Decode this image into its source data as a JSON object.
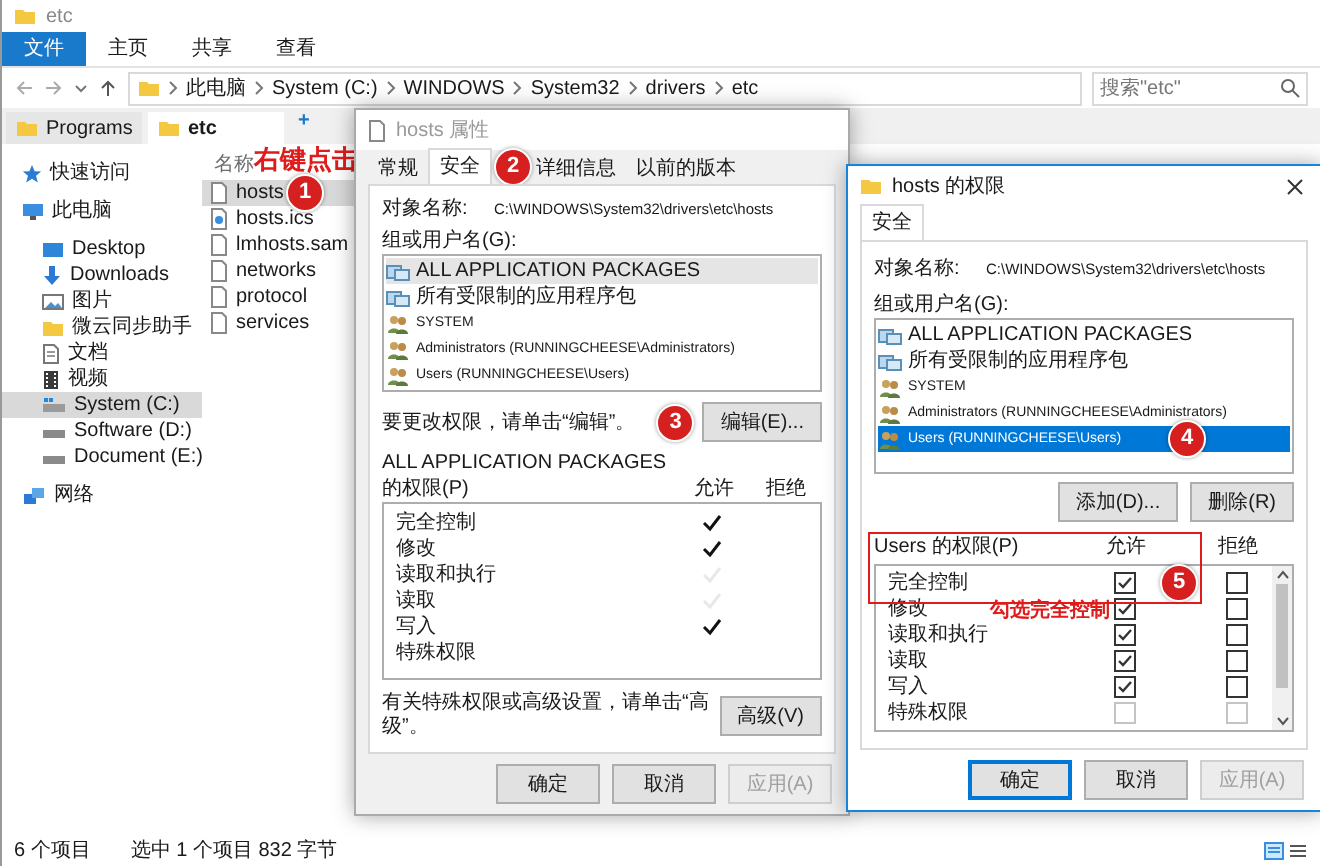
{
  "explorer": {
    "title": "etc",
    "ribbon_tabs": [
      {
        "label": "文件",
        "selected": true
      },
      {
        "label": "主页",
        "selected": false
      },
      {
        "label": "共享",
        "selected": false
      },
      {
        "label": "查看",
        "selected": false
      }
    ],
    "breadcrumb": [
      "此电脑",
      "System (C:)",
      "WINDOWS",
      "System32",
      "drivers",
      "etc"
    ],
    "search": {
      "placeholder": "搜索\"etc\""
    },
    "browser_tabs": [
      {
        "label": "Programs",
        "selected": false
      },
      {
        "label": "etc",
        "selected": true
      }
    ],
    "new_tab": "+",
    "sidebar": {
      "items": [
        {
          "label": "快速访问",
          "kind": "star",
          "selected": false
        },
        {
          "label": "此电脑",
          "kind": "computer",
          "selected": false,
          "children": [
            {
              "label": "Desktop",
              "kind": "desktop",
              "selected": false
            },
            {
              "label": "Downloads",
              "kind": "download",
              "selected": false
            },
            {
              "label": "图片",
              "kind": "picture",
              "selected": false
            },
            {
              "label": "微云同步助手",
              "kind": "folder",
              "selected": false
            },
            {
              "label": "文档",
              "kind": "document",
              "selected": false
            },
            {
              "label": "视频",
              "kind": "video",
              "selected": false
            },
            {
              "label": "System (C:)",
              "kind": "system-drive",
              "selected": true
            },
            {
              "label": "Software (D:)",
              "kind": "drive",
              "selected": false
            },
            {
              "label": "Document (E:)",
              "kind": "drive",
              "selected": false
            }
          ]
        },
        {
          "label": "网络",
          "kind": "network",
          "selected": false
        }
      ]
    },
    "file_list": {
      "columns": [
        "名称"
      ],
      "files": [
        {
          "name": "hosts",
          "kind": "file",
          "selected": true
        },
        {
          "name": "hosts.ics",
          "kind": "settings-file",
          "selected": false
        },
        {
          "name": "lmhosts.sam",
          "kind": "file",
          "selected": false
        },
        {
          "name": "networks",
          "kind": "file",
          "selected": false
        },
        {
          "name": "protocol",
          "kind": "file",
          "selected": false
        },
        {
          "name": "services",
          "kind": "file",
          "selected": false
        }
      ]
    },
    "status_bar": {
      "item_count": "6 个项目",
      "selection": "选中 1 个项目  832 字节"
    }
  },
  "properties_dialog": {
    "title": "hosts 属性",
    "tabs": [
      {
        "label": "常规",
        "selected": false
      },
      {
        "label": "安全",
        "selected": true
      },
      {
        "label": "详细信息",
        "selected": false
      },
      {
        "label": "以前的版本",
        "selected": false
      }
    ],
    "object_label": "对象名称:",
    "object_path": "C:\\WINDOWS\\System32\\drivers\\etc\\hosts",
    "groups_label": "组或用户名(G):",
    "groups": [
      {
        "name": "ALL APPLICATION PACKAGES",
        "kind": "package",
        "selected": true
      },
      {
        "name": "所有受限制的应用程序包",
        "kind": "package",
        "selected": false
      },
      {
        "name": "SYSTEM",
        "kind": "user",
        "selected": false
      },
      {
        "name": "Administrators (RUNNINGCHEESE\\Administrators)",
        "kind": "user",
        "selected": false
      },
      {
        "name": "Users (RUNNINGCHEESE\\Users)",
        "kind": "user",
        "selected": false
      }
    ],
    "change_hint": "要更改权限，请单击“编辑”。",
    "edit_button": "编辑(E)...",
    "permissions_label": [
      "ALL APPLICATION PACKAGES",
      "的权限(P)"
    ],
    "allow_header": "允许",
    "deny_header": "拒绝",
    "permissions": [
      {
        "name": "完全控制",
        "allow": true,
        "greyed": false
      },
      {
        "name": "修改",
        "allow": true,
        "greyed": false
      },
      {
        "name": "读取和执行",
        "allow": true,
        "greyed": true
      },
      {
        "name": "读取",
        "allow": true,
        "greyed": true
      },
      {
        "name": "写入",
        "allow": true,
        "greyed": false
      },
      {
        "name": "特殊权限",
        "allow": false
      }
    ],
    "advanced_hint": "有关特殊权限或高级设置，请单击“高级”。",
    "advanced_button": "高级(V)",
    "buttons": [
      {
        "label": "确定",
        "default": false,
        "disabled": false
      },
      {
        "label": "取消",
        "default": false,
        "disabled": false
      },
      {
        "label": "应用(A)",
        "default": false,
        "disabled": true
      }
    ]
  },
  "permissions_dialog": {
    "title": "hosts 的权限",
    "tabs": [
      {
        "label": "安全",
        "selected": true
      }
    ],
    "object_label": "对象名称:",
    "object_path": "C:\\WINDOWS\\System32\\drivers\\etc\\hosts",
    "groups_label": "组或用户名(G):",
    "groups": [
      {
        "name": "ALL APPLICATION PACKAGES",
        "kind": "package",
        "selected": false
      },
      {
        "name": "所有受限制的应用程序包",
        "kind": "package",
        "selected": false
      },
      {
        "name": "SYSTEM",
        "kind": "user",
        "selected": false
      },
      {
        "name": "Administrators (RUNNINGCHEESE\\Administrators)",
        "kind": "user",
        "selected": false
      },
      {
        "name": "Users (RUNNINGCHEESE\\Users)",
        "kind": "user",
        "selected": true
      }
    ],
    "add_button": "添加(D)...",
    "remove_button": "删除(R)",
    "permissions_label": "Users 的权限(P)",
    "allow_header": "允许",
    "deny_header": "拒绝",
    "permissions": [
      {
        "name": "完全控制",
        "allow": true,
        "deny": false,
        "disabled": false
      },
      {
        "name": "修改",
        "allow": true,
        "deny": false,
        "disabled": false
      },
      {
        "name": "读取和执行",
        "allow": true,
        "deny": false,
        "disabled": false
      },
      {
        "name": "读取",
        "allow": true,
        "deny": false,
        "disabled": false
      },
      {
        "name": "写入",
        "allow": true,
        "deny": false,
        "disabled": false
      },
      {
        "name": "特殊权限",
        "allow": false,
        "deny": false,
        "disabled": true
      }
    ],
    "buttons": [
      {
        "label": "确定",
        "default": true,
        "disabled": false
      },
      {
        "label": "取消",
        "default": false,
        "disabled": false
      },
      {
        "label": "应用(A)",
        "default": false,
        "disabled": true
      }
    ]
  },
  "annotations": {
    "right_click_note": "右键点击",
    "check_note": "勾选完全控制",
    "steps": [
      "1",
      "2",
      "3",
      "4",
      "5"
    ]
  }
}
